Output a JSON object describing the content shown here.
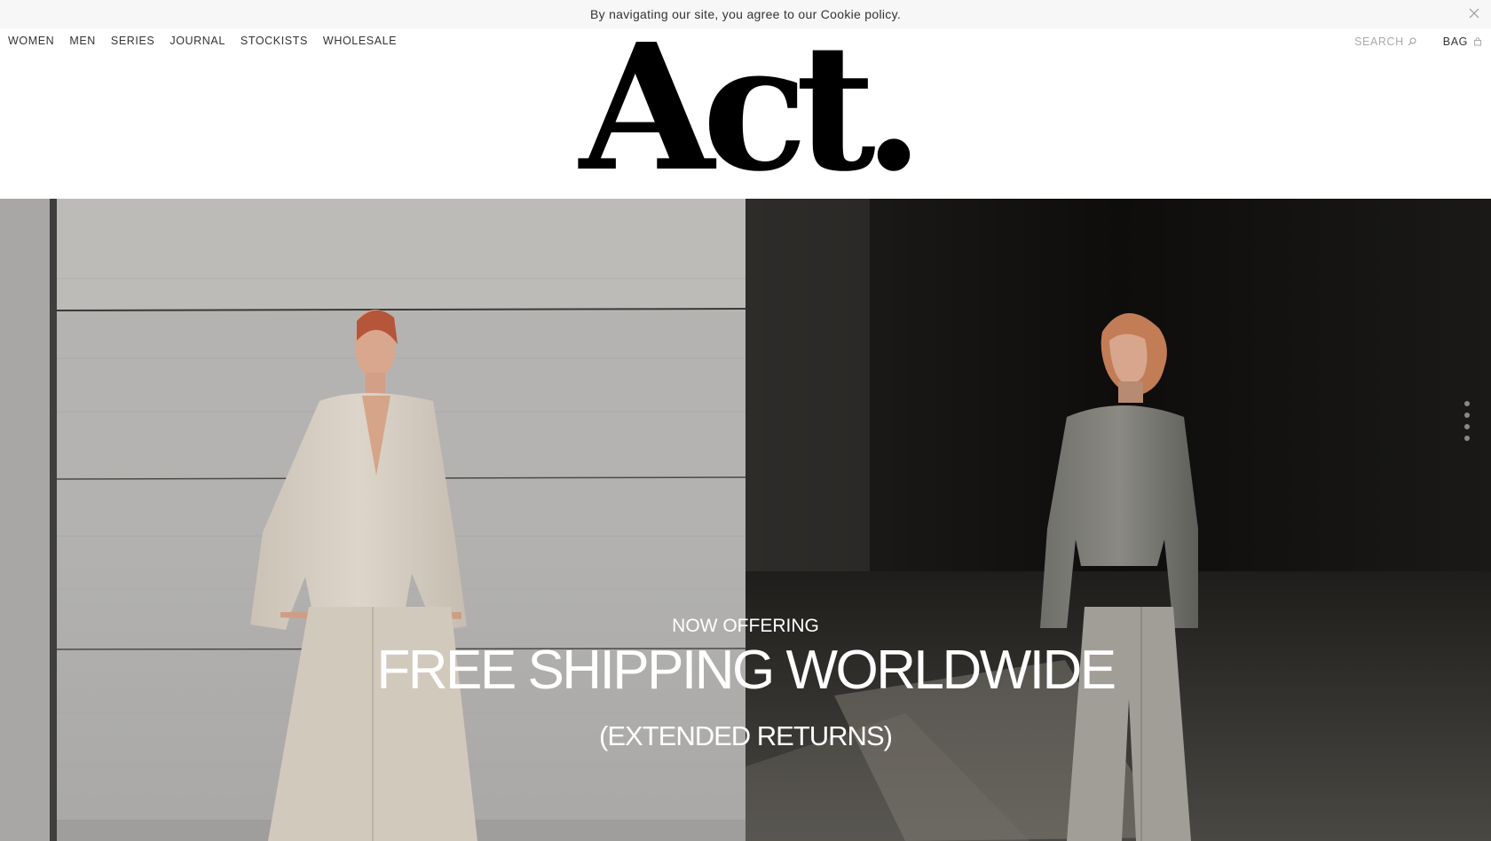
{
  "cookie": {
    "message": "By navigating our site, you agree to our Cookie policy."
  },
  "nav": {
    "items": [
      "WOMEN",
      "MEN",
      "SERIES",
      "JOURNAL",
      "STOCKISTS",
      "WHOLESALE"
    ]
  },
  "header": {
    "logo": "Act.",
    "search_label": "SEARCH",
    "bag_label": "BAG"
  },
  "hero": {
    "eyebrow": "NOW OFFERING",
    "headline": "FREE SHIPPING WORLDWIDE",
    "subline": "(EXTENDED RETURNS)",
    "slide_count": 4,
    "active_slide": 0
  },
  "icons": {
    "close": "close-icon",
    "search": "search-icon",
    "bag": "bag-icon"
  }
}
